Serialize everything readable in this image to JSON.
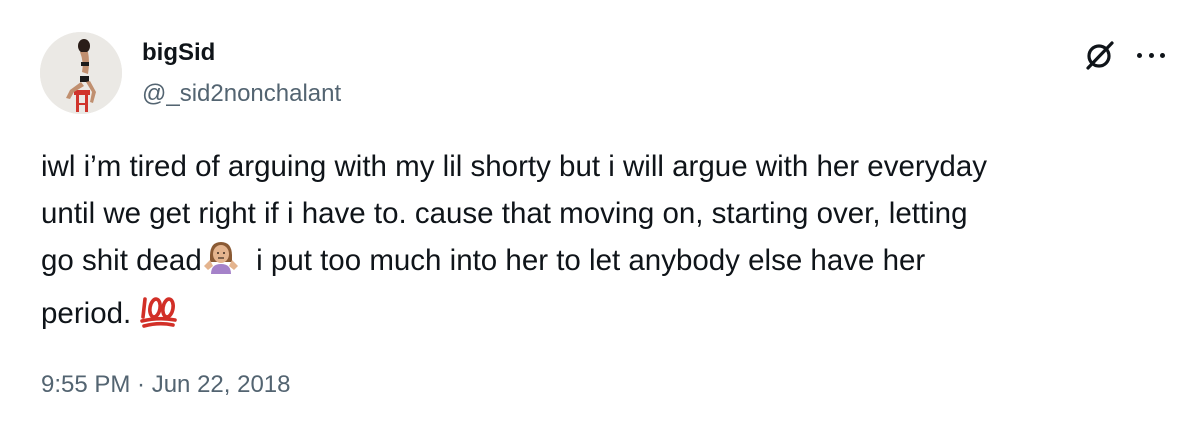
{
  "author": {
    "display_name": "bigSid",
    "handle": "@_sid2nonchalant"
  },
  "tweet": {
    "lines": [
      "iwl i’m tired of arguing with my lil shorty but i will argue with her everyday",
      "until we get right if i have to. cause that moving on, starting over, letting",
      "go shit dead",
      "i put too much into her to let anybody else have her",
      "period."
    ],
    "emojis": [
      "person-shrugging-emoji",
      "hundred-points-emoji"
    ],
    "timestamp": "9:55 PM · Jun 22, 2018"
  },
  "icons": {
    "grok": "grok-icon",
    "more": "more-options-icon"
  },
  "colors": {
    "text": "#0f1419",
    "secondary_text": "#536471",
    "background": "#ffffff",
    "hundred_red": "#d22f27"
  }
}
